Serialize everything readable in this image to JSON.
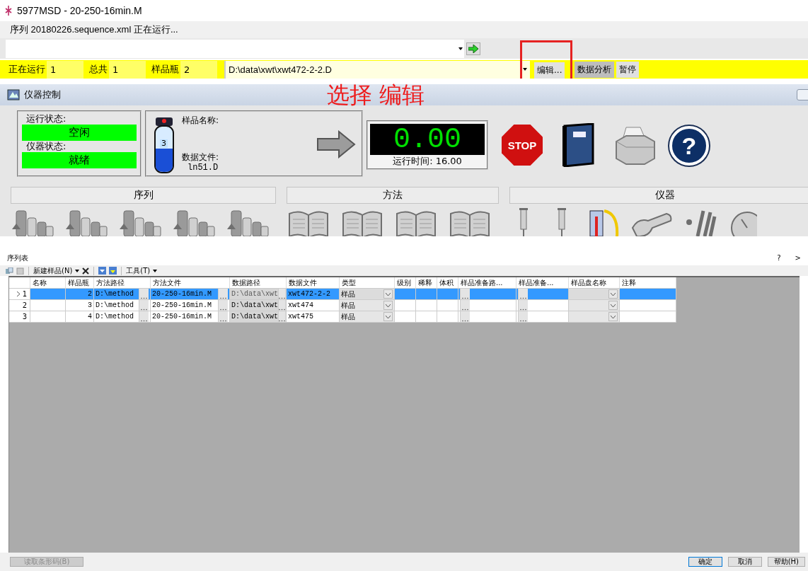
{
  "window": {
    "title": "5977MSD - 20-250-16min.M"
  },
  "status_line": "序列 20180226.sequence.xml 正在运行...",
  "run_bar": {
    "counters": [
      {
        "label": "正在运行",
        "value": "1"
      },
      {
        "label": "总共",
        "value": "1"
      },
      {
        "label": "样品瓶",
        "value": "2"
      }
    ],
    "path": "D:\\data\\xwt\\xwt472-2-2.D",
    "buttons": [
      {
        "label": "编辑...",
        "pressed": false,
        "boxed": true
      },
      {
        "label": "数据分析",
        "pressed": true,
        "boxed": false
      },
      {
        "label": "暂停",
        "pressed": false,
        "boxed": false
      }
    ]
  },
  "annotation": {
    "text": "选择 编辑"
  },
  "instrument_control": {
    "title": "仪器控制",
    "states": [
      {
        "label": "运行状态:",
        "value": "空闲"
      },
      {
        "label": "仪器状态:",
        "value": "就绪"
      }
    ],
    "sample": {
      "vial": "3",
      "name_label": "样品名称:",
      "file_label": "数据文件:",
      "file": "ln51.D"
    },
    "timer": {
      "value": "0.00",
      "caption": "运行时间: 16.00"
    },
    "stop_label": "STOP",
    "help_glyph": "?",
    "sections": [
      {
        "title": "序列",
        "tools": [
          {
            "kind": "vials"
          },
          {
            "kind": "vials"
          },
          {
            "kind": "vials"
          },
          {
            "kind": "vials"
          },
          {
            "kind": "vials"
          }
        ]
      },
      {
        "title": "方法",
        "tools": [
          {
            "kind": "book"
          },
          {
            "kind": "book"
          },
          {
            "kind": "book"
          },
          {
            "kind": "book"
          }
        ]
      },
      {
        "title": "仪器",
        "tools": [
          {
            "kind": "syringe"
          },
          {
            "kind": "syringe"
          },
          {
            "kind": "thermometer"
          },
          {
            "kind": "wrench"
          },
          {
            "kind": "tuning"
          },
          {
            "kind": "gauge"
          }
        ]
      }
    ]
  },
  "sequence_table": {
    "title": "序列表",
    "help": "?",
    "collapse": ">",
    "toolbar": {
      "new_sample": "新建样品(N)",
      "tools": "工具(T)"
    },
    "columns": [
      {
        "label": "名称",
        "kind": "text"
      },
      {
        "label": "样品瓶",
        "kind": "number"
      },
      {
        "label": "方法路径",
        "kind": "browse"
      },
      {
        "label": "方法文件",
        "kind": "browse"
      },
      {
        "label": "数据路径",
        "kind": "locked"
      },
      {
        "label": "数据文件",
        "kind": "text"
      },
      {
        "label": "类型",
        "kind": "combo"
      },
      {
        "label": "级别",
        "kind": "text"
      },
      {
        "label": "稀释",
        "kind": "text"
      },
      {
        "label": "体积",
        "kind": "text"
      },
      {
        "label": "样品准备路...",
        "kind": "browse"
      },
      {
        "label": "样品准备...",
        "kind": "browse"
      },
      {
        "label": "样品盘名称",
        "kind": "combo"
      },
      {
        "label": "注释",
        "kind": "text"
      }
    ],
    "rows": [
      {
        "number": "1",
        "selected": true,
        "current": true,
        "cells": [
          "",
          "2",
          "D:\\method",
          "20-250-16min.M",
          "D:\\data\\xwt",
          "xwt472-2-2",
          "样品"
        ]
      },
      {
        "number": "2",
        "selected": false,
        "current": false,
        "cells": [
          "",
          "3",
          "D:\\method",
          "20-250-16min.M",
          "D:\\data\\xwt",
          "xwt474",
          "样品"
        ]
      },
      {
        "number": "3",
        "selected": false,
        "current": false,
        "cells": [
          "",
          "4",
          "D:\\method",
          "20-250-16min.M",
          "D:\\data\\xwt",
          "xwt475",
          "样品"
        ]
      }
    ],
    "buttons": [
      {
        "label": "读取条形码(B)",
        "disabled": true,
        "default": false
      },
      {
        "label": "确定",
        "disabled": false,
        "default": true
      },
      {
        "label": "取消",
        "disabled": false,
        "default": false
      },
      {
        "label": "帮助(H)",
        "disabled": false,
        "default": false
      }
    ]
  }
}
